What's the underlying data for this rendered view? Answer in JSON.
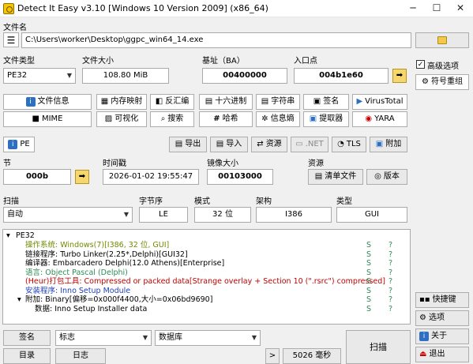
{
  "window": {
    "title": "Detect It Easy v3.10 [Windows 10 Version 2009] (x86_64)",
    "minimize": "─",
    "maximize": "☐",
    "close": "✕"
  },
  "file": {
    "label": "文件名",
    "path": "C:\\Users\\worker\\Desktop\\ggpc_win64_14.exe"
  },
  "info": {
    "type_label": "文件类型",
    "type_value": "PE32",
    "size_label": "文件大小",
    "size_value": "108.80 MiB",
    "base_label": "基址（BA）",
    "base_value": "00400000",
    "entry_label": "入口点",
    "entry_value": "004b1e60"
  },
  "side": {
    "advanced_label": "高级选项",
    "advanced_checked": "✓",
    "reorg_label": "符号重组"
  },
  "tools_row1": [
    "文件信息",
    "内存映射",
    "反汇编",
    "十六进制",
    "字符串",
    "签名",
    "VirusTotal"
  ],
  "tools_row2": [
    "MIME",
    "可视化",
    "搜索",
    "哈希",
    "信息熵",
    "提取器",
    "YARA"
  ],
  "pe": {
    "pe_label": "PE",
    "export_label": "导出",
    "import_label": "导入",
    "resource_label": "资源",
    "net_label": ".NET",
    "tls_label": "TLS",
    "overlay_label": "附加"
  },
  "sections": {
    "section_label": "节",
    "section_value": "000b",
    "time_label": "时间戳",
    "time_value": "2026-01-02 19:55:47",
    "image_label": "镜像大小",
    "image_value": "00103000",
    "res_label": "资源",
    "manifest_label": "清单文件",
    "version_label": "版本"
  },
  "scan_opts": {
    "scan_label": "扫描",
    "scan_value": "自动",
    "endian_label": "字节序",
    "endian_value": "LE",
    "mode_label": "模式",
    "mode_value": "32 位",
    "arch_label": "架构",
    "arch_value": "I386",
    "type_label": "类型",
    "type_value": "GUI"
  },
  "results": {
    "root": "PE32",
    "rows": [
      {
        "text": "操作系统: Windows(7)[I386, 32 位, GUI]",
        "color": "#6e8a00",
        "s": "S",
        "q": "?"
      },
      {
        "text": "链接程序: Turbo Linker(2.25*,Delphi)[GUI32]",
        "color": "#000000",
        "s": "S",
        "q": "?"
      },
      {
        "text": "编译器: Embarcadero Delphi(12.0 Athens)[Enterprise]",
        "color": "#000000",
        "s": "S",
        "q": "?"
      },
      {
        "text": "语言: Object Pascal (Delphi)",
        "color": "#2e8b57",
        "s": "S",
        "q": "?"
      },
      {
        "text": "(Heur)打包工具: Compressed or packed data[Strange overlay + Section 10 (\".rsrc\") compressed]",
        "color": "#c00000",
        "s": "S",
        "q": "?"
      },
      {
        "text": "安装程序: Inno Setup Module",
        "color": "#1f3fbf",
        "s": "S",
        "q": "?"
      },
      {
        "text": "附加: Binary[偏移=0x000f4400,大小=0x06bd9690]",
        "color": "#000000",
        "s": "S",
        "q": "?"
      },
      {
        "text": "数据: Inno Setup Installer data",
        "color": "#000000",
        "s": "S",
        "q": "?"
      }
    ]
  },
  "bottom": {
    "sign_label": "签名",
    "log_label": "标志",
    "db_label": "数据库",
    "dir_label": "目录",
    "log2_label": "日志",
    "next_label": ">",
    "time_label": "5026 毫秒",
    "scan_label": "扫描"
  },
  "side_bottom": {
    "shortcut_label": "快捷键",
    "options_label": "选项",
    "about_label": "关于",
    "exit_label": "退出"
  }
}
